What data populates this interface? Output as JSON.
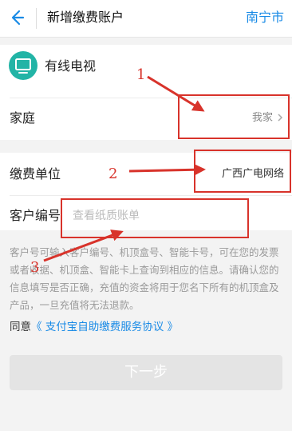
{
  "header": {
    "back_icon": "back-arrow-icon",
    "title": "新增缴费账户",
    "city": "南宁市"
  },
  "service": {
    "icon": "tv-icon",
    "label": "有线电视"
  },
  "family": {
    "label": "家庭",
    "value": "我家",
    "chevron_icon": "chevron-right-icon"
  },
  "unit": {
    "label": "缴费单位",
    "value": "广西广电网络"
  },
  "customer": {
    "label": "客户编号",
    "placeholder": "查看纸质账单",
    "value": ""
  },
  "notice": "客户号可输入客户编号、机顶盒号、智能卡号，可在您的发票或者收据、机顶盒、智能卡上查询到相应的信息。请确认您的信息填写是否正确，充值的资金将用于您名下所有的机顶盒及产品，一旦充值将无法退款。",
  "agreement": {
    "prefix": "同意",
    "link": "《 支付宝自助缴费服务协议 》"
  },
  "next_button": "下一步",
  "annotations": {
    "color": "#d8332b",
    "labels": [
      "1",
      "2",
      "3"
    ]
  },
  "colors": {
    "accent": "#1a8be6",
    "tv_icon": "#22b4a6",
    "button_disabled": "#e4e4e4"
  }
}
